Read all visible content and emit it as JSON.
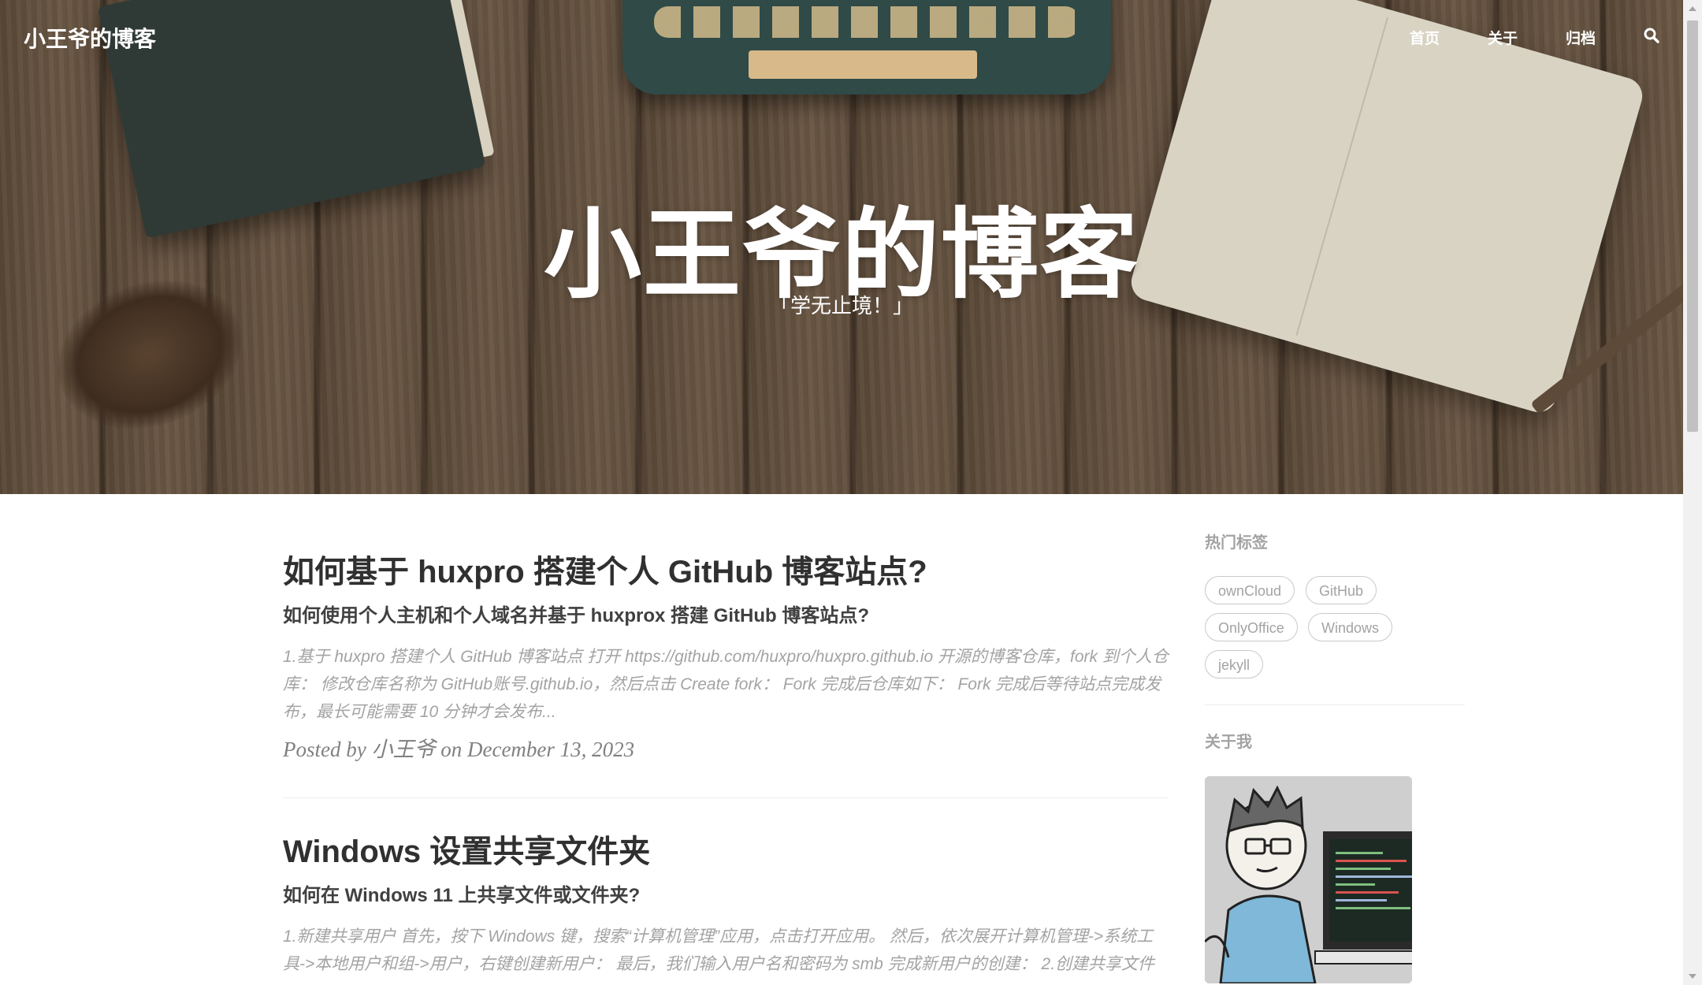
{
  "header": {
    "brand": "小王爷的博客",
    "nav": {
      "home": "首页",
      "about": "关于",
      "archive": "归档"
    },
    "search_icon": "search-icon"
  },
  "hero": {
    "title": "小王爷的博客",
    "subtitle": "「学无止境！」"
  },
  "posts": [
    {
      "title": "如何基于 huxpro 搭建个人 GitHub 博客站点?",
      "subtitle": "如何使用个人主机和个人域名并基于 huxprox 搭建 GitHub 博客站点?",
      "excerpt": "1.基于 huxpro 搭建个人 GitHub 博客站点 打开 https://github.com/huxpro/huxpro.github.io 开源的博客仓库，fork 到个人仓库： 修改仓库名称为 GitHub账号.github.io，然后点击 Create fork： Fork 完成后仓库如下： Fork 完成后等待站点完成发布，最长可能需要 10 分钟才会发布...",
      "meta_prefix": "Posted by",
      "author": "小王爷",
      "meta_on": "on",
      "date": "December 13, 2023"
    },
    {
      "title": "Windows 设置共享文件夹",
      "subtitle": "如何在 Windows 11 上共享文件或文件夹?",
      "excerpt": "1.新建共享用户 首先，按下 Windows 键，搜索“计算机管理”应用，点击打开应用。 然后，依次展开计算机管理->系统工具->本地用户和组->用户，右键创建新用户： 最后，我们输入用户名和密码为 smb 完成新用户的创建： 2.创建共享文件"
    }
  ],
  "sidebar": {
    "tags_heading": "热门标签",
    "tags": [
      "ownCloud",
      "GitHub",
      "OnlyOffice",
      "Windows",
      "jekyll"
    ],
    "about_heading": "关于我"
  }
}
